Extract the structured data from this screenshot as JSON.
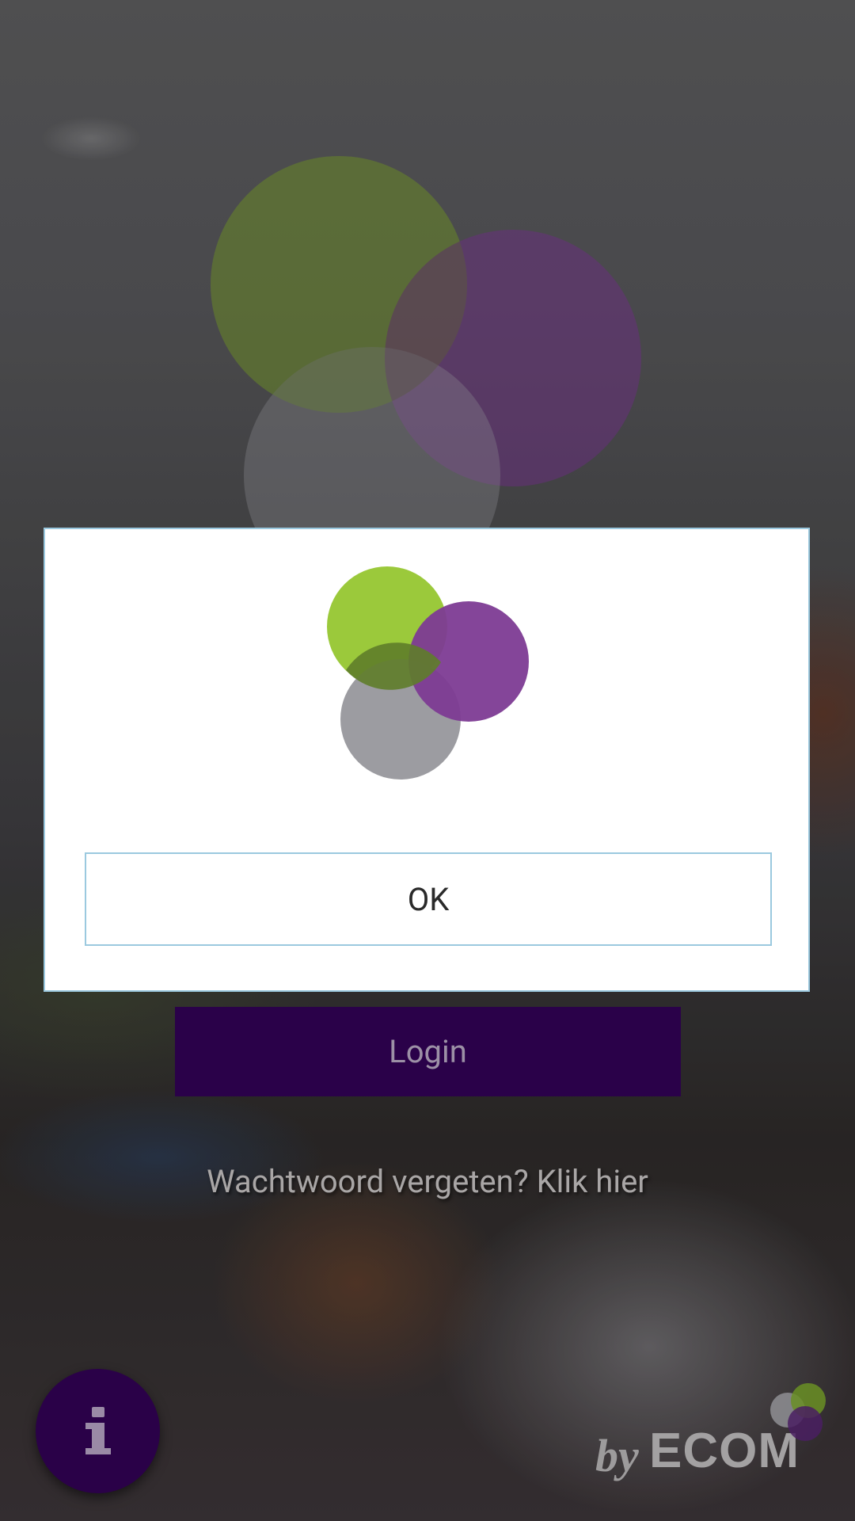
{
  "dialog": {
    "ok_label": "OK"
  },
  "login": {
    "button_label": "Login",
    "forgot_password_link": "Wachtwoord vergeten? Klik hier"
  },
  "info_button": {
    "icon": "info-icon"
  },
  "brand": {
    "by_text": "by",
    "name": "ECOM"
  },
  "colors": {
    "logo_green": "#9bc93b",
    "logo_purple": "#7d3b94",
    "logo_gray": "#97979c",
    "login_button_bg": "#2a0149",
    "dialog_border": "#9bc9df"
  }
}
